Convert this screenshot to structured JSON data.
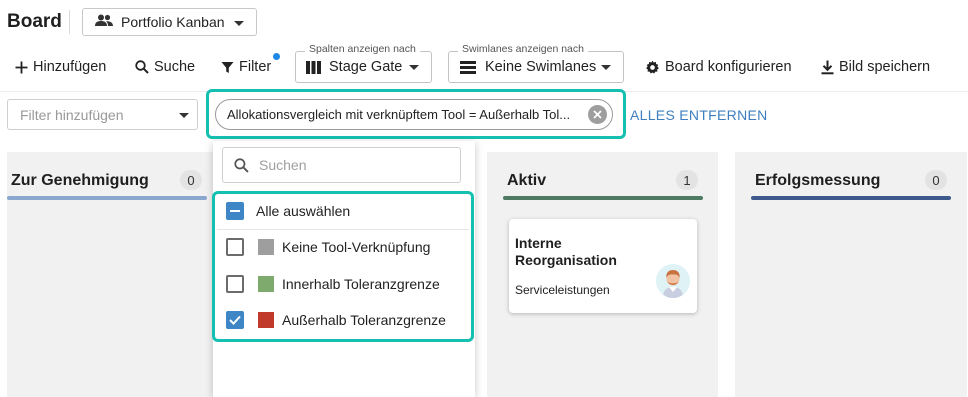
{
  "header": {
    "title": "Board",
    "board_select": {
      "value": "Portfolio Kanban",
      "icon": "people-icon"
    }
  },
  "toolbar": {
    "add_label": "Hinzufügen",
    "search_label": "Suche",
    "filter_label": "Filter",
    "filter_active": true,
    "columns_select": {
      "floating_label": "Spalten anzeigen nach",
      "value": "Stage Gate"
    },
    "swimlanes_select": {
      "floating_label": "Swimlanes anzeigen nach",
      "value": "Keine Swimlanes"
    },
    "configure_label": "Board konfigurieren",
    "save_image_label": "Bild speichern"
  },
  "filter_bar": {
    "add_filter_placeholder": "Filter hinzufügen",
    "active_chip": "Allokationsvergleich mit verknüpftem Tool = Außerhalb Tol...",
    "remove_all_label": "ALLES ENTFERNEN"
  },
  "dropdown": {
    "search_placeholder": "Suchen",
    "select_all_label": "Alle auswählen",
    "options": [
      {
        "label": "Keine Tool-Verknüpfung",
        "color": "#9e9e9e",
        "checked": false
      },
      {
        "label": "Innerhalb Toleranzgrenze",
        "color": "#7faa6e",
        "checked": false
      },
      {
        "label": "Außerhalb Toleranzgrenze",
        "color": "#c0392b",
        "checked": true
      }
    ]
  },
  "columns": [
    {
      "title": "Zur Genehmigung",
      "count": "0",
      "color": "#8aa7cf"
    },
    {
      "title": "",
      "count": "",
      "color": "#cccccc"
    },
    {
      "title": "Aktiv",
      "count": "1",
      "color": "#4e7a61"
    },
    {
      "title": "Erfolgsmessung",
      "count": "0",
      "color": "#3e5a8c"
    }
  ],
  "card": {
    "title": "Interne Reorganisation",
    "subtitle": "Serviceleistungen",
    "avatar": "person-avatar"
  },
  "colors": {
    "highlight": "#15c0b0",
    "accent_blue": "#3f86c7",
    "link_blue": "#3f7fbf"
  }
}
